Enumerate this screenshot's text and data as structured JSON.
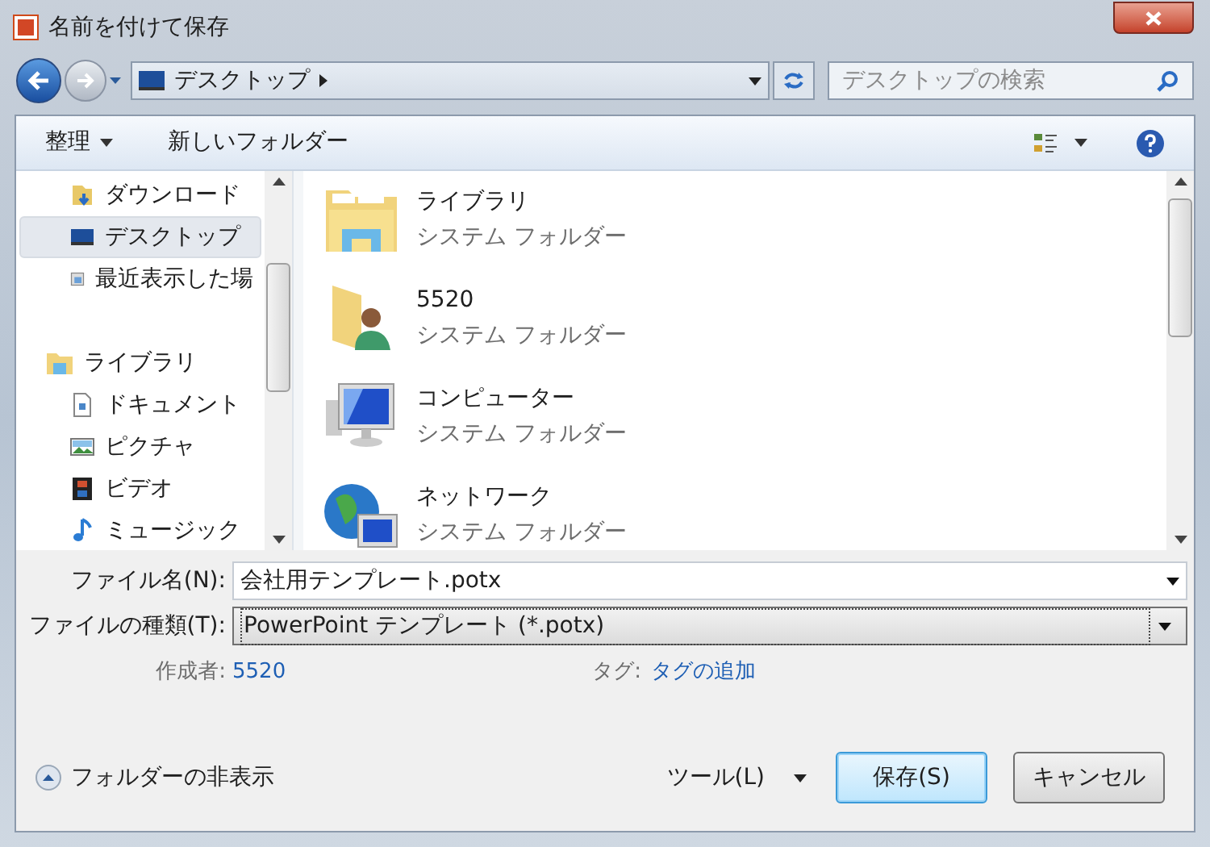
{
  "window": {
    "title": "名前を付けて保存"
  },
  "address": {
    "location": "デスクトップ",
    "search_placeholder": "デスクトップの検索"
  },
  "toolbar": {
    "organize": "整理",
    "new_folder": "新しいフォルダー"
  },
  "sidebar": {
    "favorites": [
      {
        "label": "ダウンロード",
        "kind": "download",
        "selected": false
      },
      {
        "label": "デスクトップ",
        "kind": "desktop",
        "selected": true
      },
      {
        "label": "最近表示した場",
        "kind": "recent",
        "selected": false
      }
    ],
    "library": {
      "label": "ライブラリ",
      "children": [
        {
          "label": "ドキュメント",
          "kind": "document",
          "selected": false
        },
        {
          "label": "ピクチャ",
          "kind": "picture",
          "selected": false
        },
        {
          "label": "ビデオ",
          "kind": "video",
          "selected": false
        },
        {
          "label": "ミュージック",
          "kind": "music",
          "selected": false
        }
      ]
    }
  },
  "items": [
    {
      "name": "ライブラリ",
      "type": "システム フォルダー",
      "kind": "library"
    },
    {
      "name": "5520",
      "type": "システム フォルダー",
      "kind": "user"
    },
    {
      "name": "コンピューター",
      "type": "システム フォルダー",
      "kind": "computer"
    },
    {
      "name": "ネットワーク",
      "type": "システム フォルダー",
      "kind": "network"
    }
  ],
  "form": {
    "filename_label": "ファイル名(N):",
    "filename": "会社用テンプレート.potx",
    "filetype_label": "ファイルの種類(T):",
    "filetype": "PowerPoint テンプレート (*.potx)",
    "author_label": "作成者:",
    "author": "5520",
    "tag_label": "タグ:",
    "tag": "タグの追加"
  },
  "footer": {
    "hide_folders": "フォルダーの非表示",
    "tools": "ツール(L)",
    "save": "保存(S)",
    "cancel": "キャンセル"
  }
}
